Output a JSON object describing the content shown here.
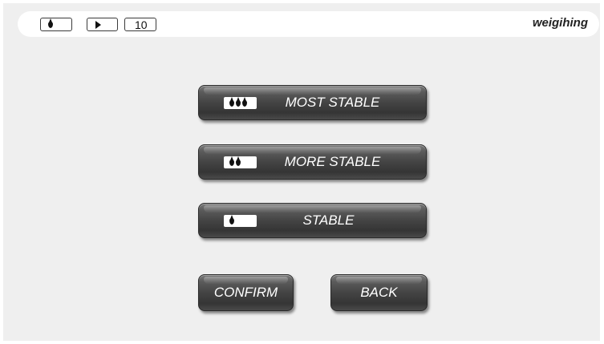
{
  "header": {
    "title": "weigihing",
    "indicators": {
      "drop_icon": "drop-icon",
      "play_icon": "play-icon",
      "count": "10"
    }
  },
  "options": [
    {
      "label": "MOST STABLE",
      "level": 3,
      "icon": "drop-icon"
    },
    {
      "label": "MORE STABLE",
      "level": 2,
      "icon": "drop-icon"
    },
    {
      "label": "STABLE",
      "level": 1,
      "icon": "drop-icon"
    }
  ],
  "actions": {
    "confirm_label": "CONFIRM",
    "back_label": "BACK"
  },
  "colors": {
    "background": "#efefef",
    "button_dark": "#3c3c3c",
    "button_text": "#ffffff",
    "header_bar": "#ffffff"
  }
}
